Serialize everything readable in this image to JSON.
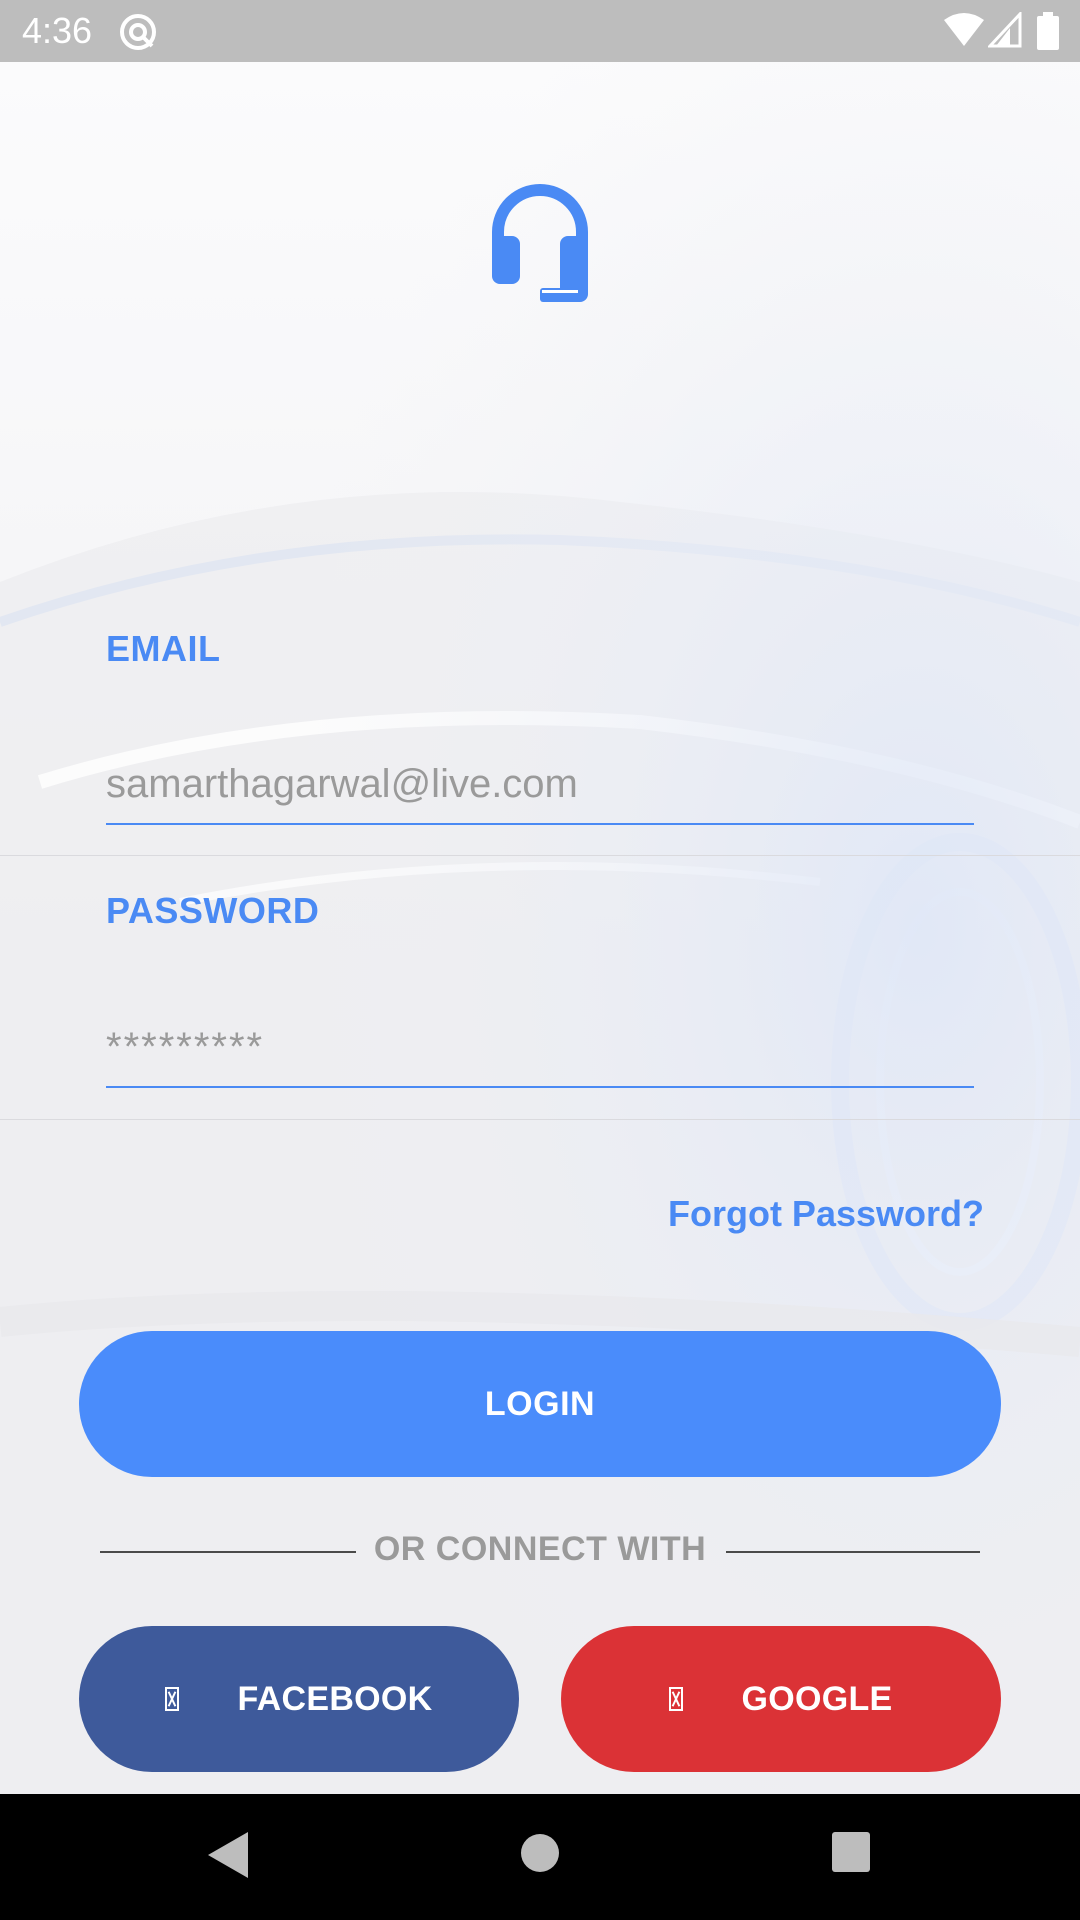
{
  "status_bar": {
    "time": "4:36",
    "icons": [
      "app-notification-icon",
      "wifi-icon",
      "cell-signal-icon",
      "battery-icon"
    ]
  },
  "logo": {
    "icon": "headset-icon",
    "color": "#4a8af4"
  },
  "form": {
    "email": {
      "label": "EMAIL",
      "placeholder": "samarthagarwal@live.com"
    },
    "password": {
      "label": "PASSWORD",
      "placeholder": "*********"
    },
    "forgot_password": "Forgot Password?"
  },
  "buttons": {
    "login": "LOGIN",
    "divider_text": "OR CONNECT WITH",
    "facebook": "FACEBOOK",
    "google": "GOOGLE"
  },
  "colors": {
    "accent": "#4a8af4",
    "login_button": "#4a8cfb",
    "facebook": "#3e5a9b",
    "google": "#db3236",
    "status_bar": "#bdbdbd"
  },
  "nav_bar": {
    "icons": [
      "back-icon",
      "home-icon",
      "recents-icon"
    ]
  }
}
